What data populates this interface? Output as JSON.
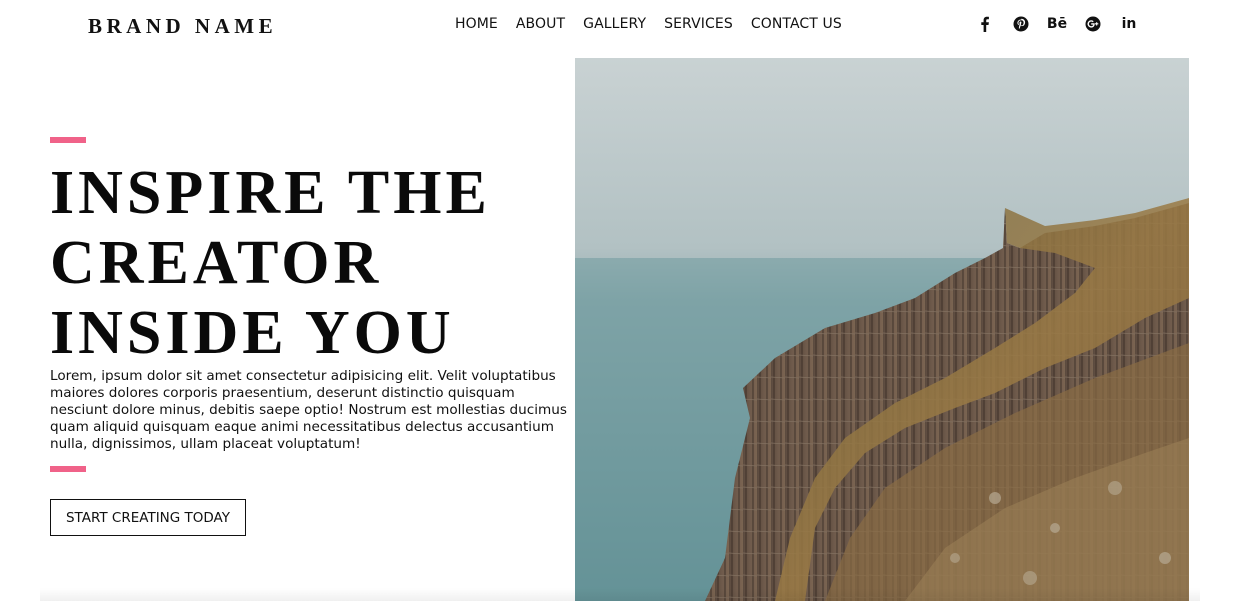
{
  "header": {
    "brand": "BRAND NAME",
    "nav": [
      {
        "label": "HOME"
      },
      {
        "label": "ABOUT"
      },
      {
        "label": "GALLERY"
      },
      {
        "label": "SERVICES"
      },
      {
        "label": "CONTACT US"
      }
    ],
    "social": [
      {
        "icon": "facebook-icon"
      },
      {
        "icon": "pinterest-icon"
      },
      {
        "icon": "behance-icon",
        "glyph": "Bē"
      },
      {
        "icon": "google-plus-icon"
      },
      {
        "icon": "linkedin-icon",
        "glyph": "in"
      }
    ]
  },
  "hero": {
    "headline_lines": [
      "INSPIRE THE",
      "CREATOR",
      "INSIDE YOU"
    ],
    "description": "Lorem, ipsum dolor sit amet consectetur adipisicing elit. Velit voluptatibus maiores dolores corporis praesentium, deserunt distinctio quisquam nesciunt dolore minus, debitis saepe optio! Nostrum est mollestias ducimus quam aliquid quisquam eaque animi necessitatibus delectus accusantium nulla, dignissimos, ullam placeat voluptatum!",
    "cta_label": "START CREATING TODAY",
    "image_icon": "sea-cliff-photo"
  },
  "colors": {
    "accent": "#f06289",
    "text": "#111111",
    "background": "#ffffff"
  }
}
